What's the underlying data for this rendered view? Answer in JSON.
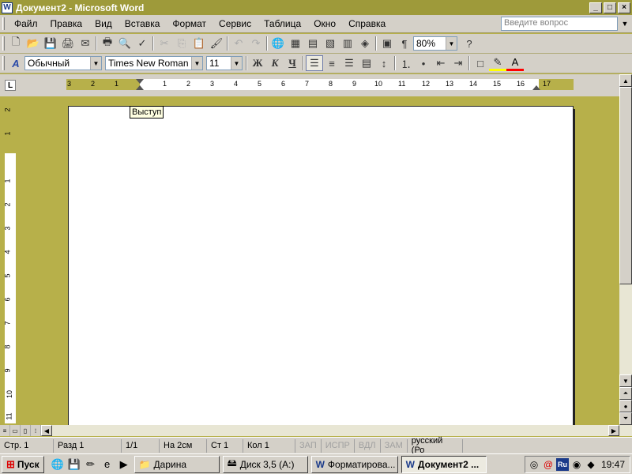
{
  "window": {
    "title": "Документ2 - Microsoft Word",
    "app_icon": "W",
    "minimize_glyph": "_",
    "maximize_glyph": "□",
    "close_glyph": "×"
  },
  "menu": {
    "items": [
      "Файл",
      "Правка",
      "Вид",
      "Вставка",
      "Формат",
      "Сервис",
      "Таблица",
      "Окно",
      "Справка"
    ],
    "ask_placeholder": "Введите вопрос"
  },
  "standard_toolbar": {
    "zoom": "80%"
  },
  "formatting_toolbar": {
    "style": "Обычный",
    "font": "Times New Roman",
    "size": "11",
    "bold_label": "Ж",
    "italic_label": "К",
    "underline_label": "Ч"
  },
  "ruler": {
    "tab_selector": "L",
    "left_numbers": [
      "3",
      "2",
      "1"
    ],
    "right_numbers": [
      "1",
      "2",
      "3",
      "4",
      "5",
      "6",
      "7",
      "8",
      "9",
      "10",
      "11",
      "12",
      "13",
      "14",
      "15",
      "16",
      "17"
    ],
    "vertical_numbers": [
      "2",
      "1",
      "1",
      "2",
      "3",
      "4",
      "5",
      "6",
      "7",
      "8",
      "9",
      "10",
      "11"
    ]
  },
  "tooltip": "Выступ",
  "status": {
    "page": "Стр. 1",
    "section": "Разд 1",
    "pages": "1/1",
    "at": "На 2см",
    "line": "Ст 1",
    "col": "Кол 1",
    "rec": "ЗАП",
    "trk": "ИСПР",
    "ext": "ВДЛ",
    "ovr": "ЗАМ",
    "language": "русский (Ро"
  },
  "taskbar": {
    "start_label": "Пуск",
    "tasks": [
      {
        "label": "Дарина",
        "active": false
      },
      {
        "label": "Диск 3,5 (A:)",
        "active": false
      },
      {
        "label": "Форматирова...",
        "active": false
      },
      {
        "label": "Документ2 ...",
        "active": true
      }
    ],
    "tray_ru": "Ru",
    "clock": "19:47"
  }
}
